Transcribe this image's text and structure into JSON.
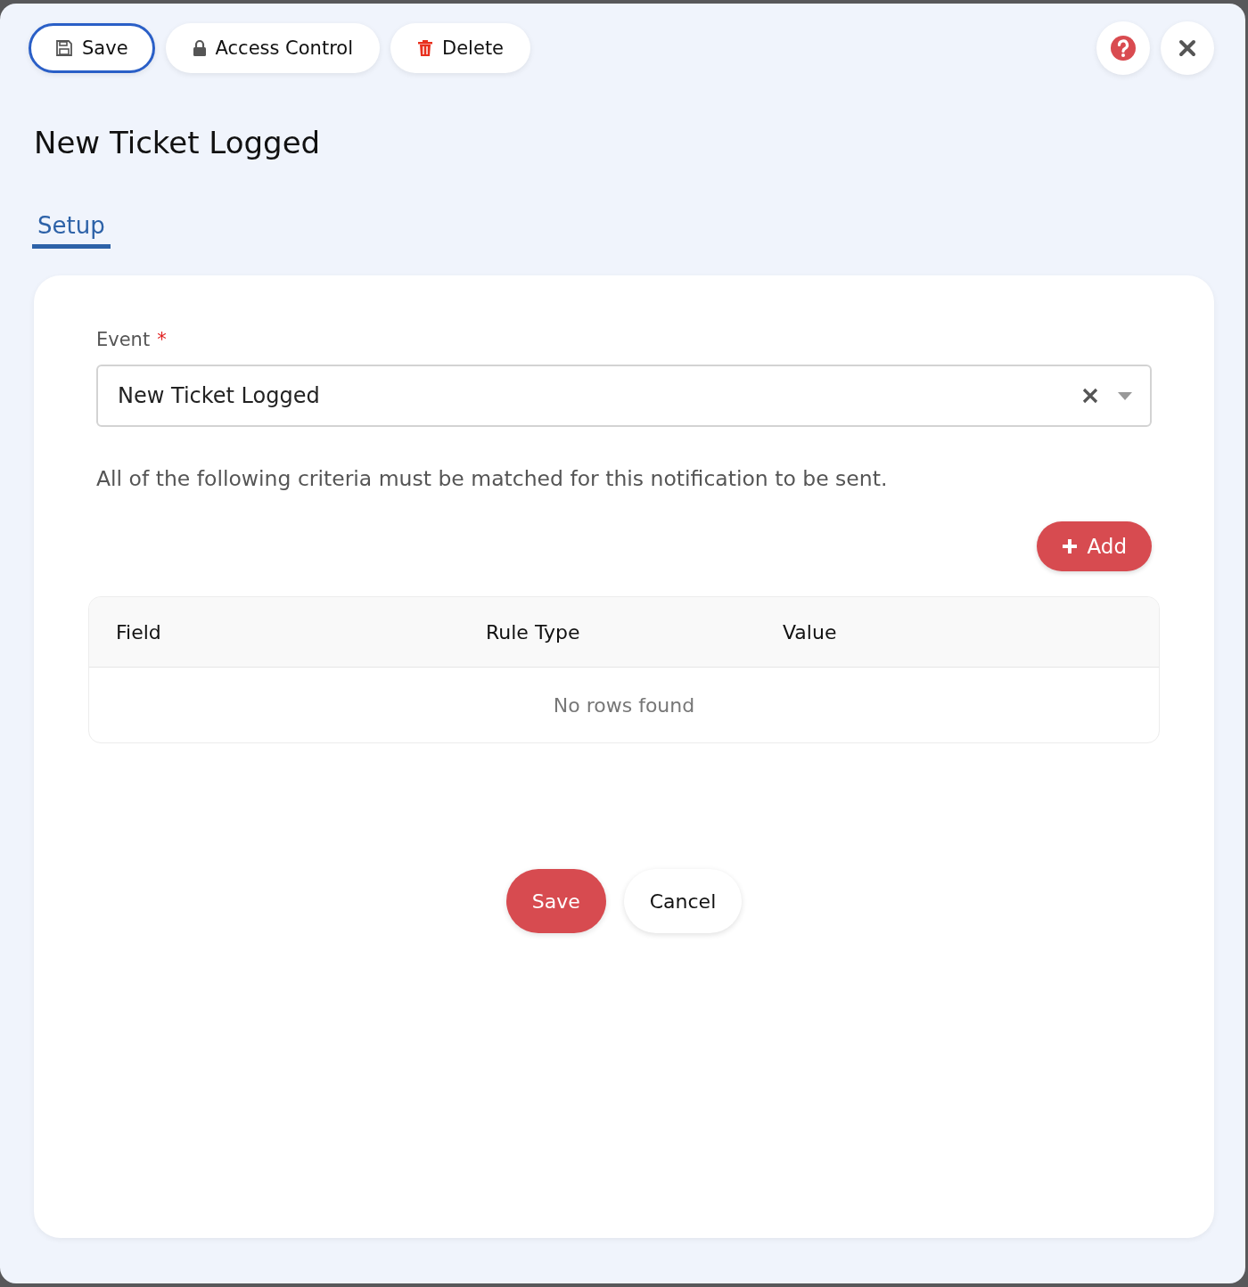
{
  "toolbar": {
    "buttons": [
      {
        "kind": "save",
        "label": "Save",
        "focused": true
      },
      {
        "kind": "lock",
        "label": "Access Control",
        "focused": false
      },
      {
        "kind": "delete",
        "label": "Delete",
        "focused": false
      }
    ],
    "icon_buttons": [
      {
        "kind": "help"
      },
      {
        "kind": "close"
      }
    ]
  },
  "title": "New Ticket Logged",
  "tabs": [
    {
      "label": "Setup",
      "selected": true
    }
  ],
  "form": {
    "event": {
      "label": "Event",
      "required_mark": "*",
      "value": "New Ticket Logged"
    },
    "criteria_text": "All of the following criteria must be matched for this notification to be sent.",
    "add_button": {
      "label": "Add"
    },
    "table": {
      "columns": [
        "Field",
        "Rule Type",
        "Value"
      ],
      "empty_message": "No rows found"
    }
  },
  "footer": {
    "buttons": [
      {
        "kind": "primary",
        "label": "Save"
      },
      {
        "kind": "secondary",
        "label": "Cancel"
      }
    ]
  }
}
